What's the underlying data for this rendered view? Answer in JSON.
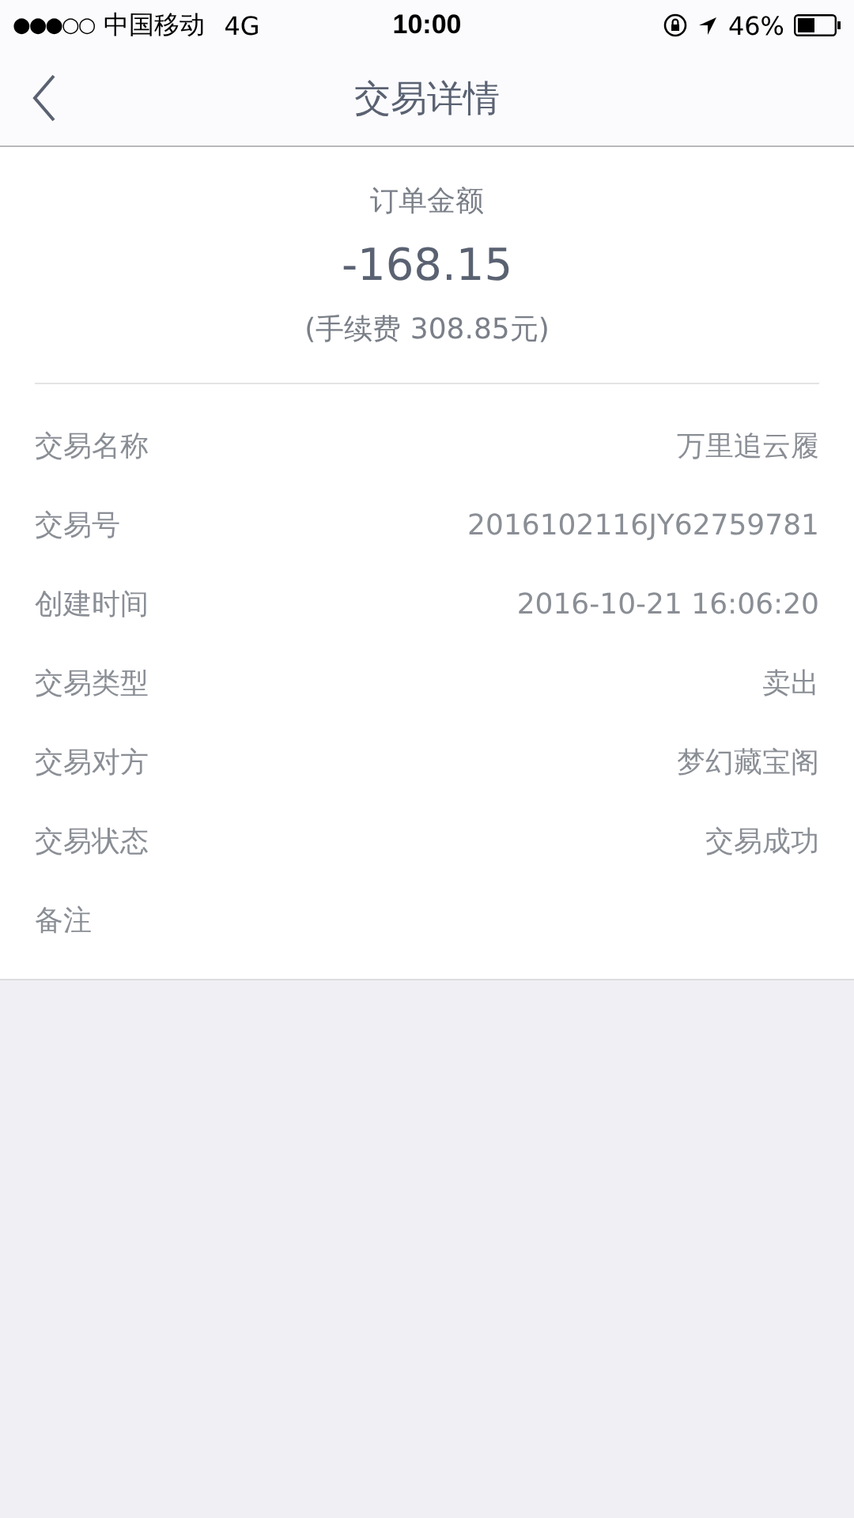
{
  "status_bar": {
    "signal": "●●●○○",
    "carrier": "中国移动",
    "network": "4G",
    "time": "10:00",
    "battery": "46%"
  },
  "nav": {
    "title": "交易详情"
  },
  "summary": {
    "label": "订单金额",
    "amount": "-168.15",
    "fee": "(手续费 308.85元)"
  },
  "rows": [
    {
      "label": "交易名称",
      "value": "万里追云履"
    },
    {
      "label": "交易号",
      "value": "2016102116JY62759781"
    },
    {
      "label": "创建时间",
      "value": "2016-10-21 16:06:20"
    },
    {
      "label": "交易类型",
      "value": "卖出"
    },
    {
      "label": "交易对方",
      "value": "梦幻藏宝阁"
    },
    {
      "label": "交易状态",
      "value": "交易成功"
    },
    {
      "label": "备注"
    }
  ]
}
